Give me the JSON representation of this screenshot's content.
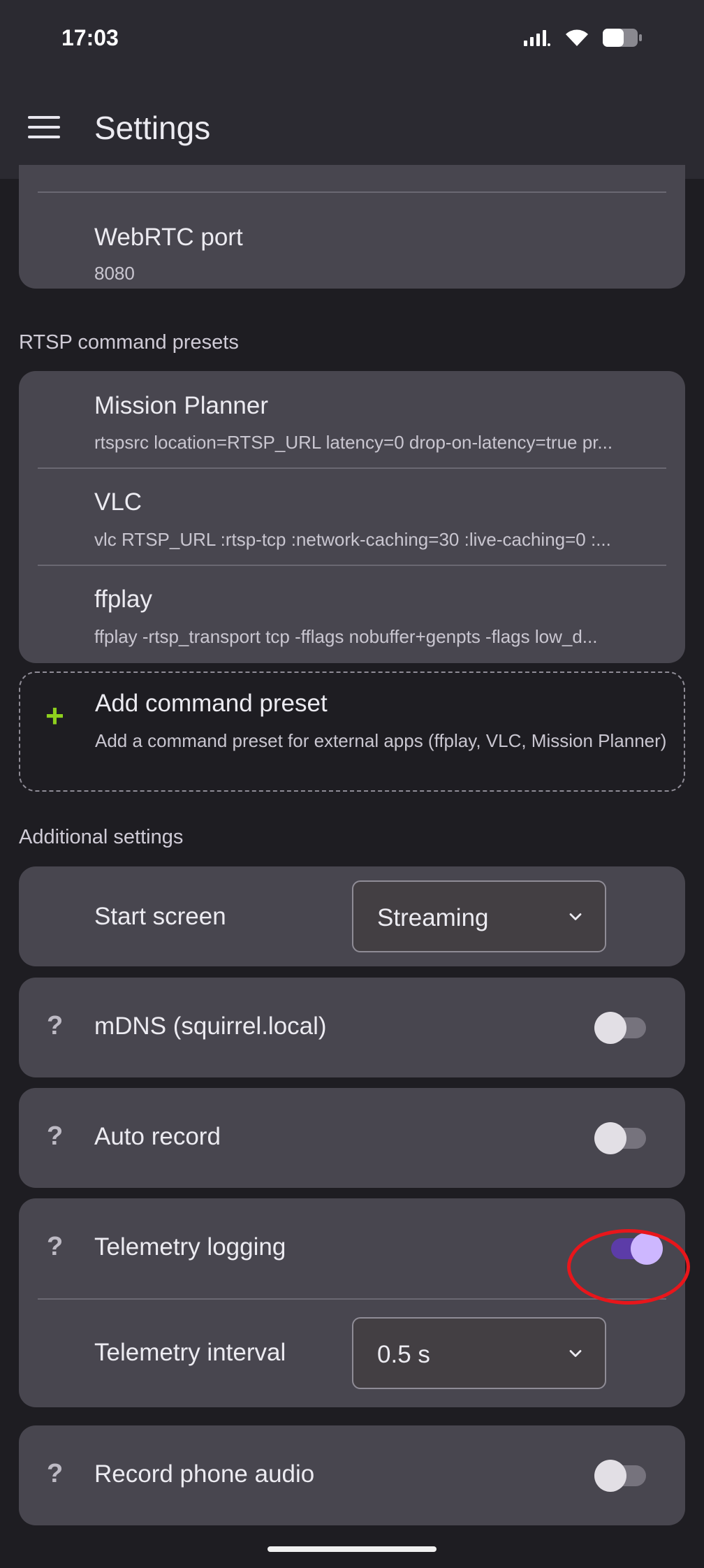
{
  "status_bar": {
    "time": "17:03",
    "battery_level": 0.6
  },
  "app_bar": {
    "title": "Settings",
    "menu_icon": "hamburger-menu-icon"
  },
  "webrtc": {
    "title": "WebRTC port",
    "value": "8080"
  },
  "sections": {
    "rtsp_presets": "RTSP command presets",
    "additional": "Additional settings"
  },
  "presets": [
    {
      "name": "Mission Planner",
      "command": "rtspsrc location=RTSP_URL latency=0 drop-on-latency=true pr..."
    },
    {
      "name": "VLC",
      "command": "vlc RTSP_URL :rtsp-tcp :network-caching=30 :live-caching=0 :..."
    },
    {
      "name": "ffplay",
      "command": "ffplay -rtsp_transport tcp -fflags nobuffer+genpts -flags low_d..."
    }
  ],
  "add_preset": {
    "title": "Add command preset",
    "description": "Add a command preset for external apps (ffplay, VLC, Mission Planner)",
    "icon": "plus-icon",
    "icon_color": "#8ed01e"
  },
  "start_screen": {
    "label": "Start screen",
    "value": "Streaming"
  },
  "toggles": {
    "mdns": {
      "label": "mDNS (squirrel.local)",
      "on": false
    },
    "auto_record": {
      "label": "Auto record",
      "on": false
    },
    "telemetry_logging": {
      "label": "Telemetry logging",
      "on": true
    },
    "record_audio": {
      "label": "Record phone audio",
      "on": false
    }
  },
  "telemetry_interval": {
    "label": "Telemetry interval",
    "value": "0.5 s"
  },
  "help_glyph": "?",
  "colors": {
    "background": "#1e1d22",
    "card": "#48464f",
    "switch_on_track": "#5c3ca8",
    "switch_on_thumb": "#cdb7ff",
    "highlight": "#e8161b"
  }
}
